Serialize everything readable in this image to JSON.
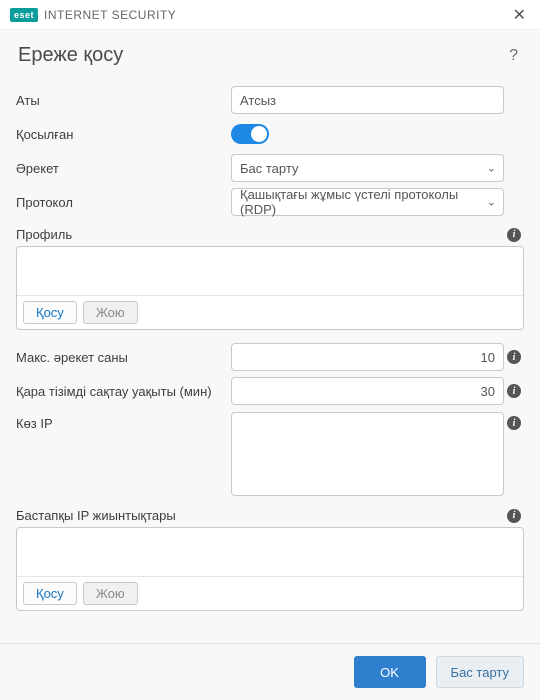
{
  "brand": {
    "badge": "eset",
    "product": "INTERNET SECURITY"
  },
  "window": {
    "close_glyph": "✕"
  },
  "header": {
    "title": "Ереже қосу",
    "help_glyph": "?"
  },
  "labels": {
    "name": "Аты",
    "enabled": "Қосылған",
    "action": "Әрекет",
    "protocol": "Протокол",
    "profile": "Профиль",
    "max_attempts": "Макс. әрекет саны",
    "blacklist_retention": "Қара тізімді сақтау уақыты (мин)",
    "source_ip": "Көз IP",
    "source_ip_sets": "Бастапқы IP жиынтықтары"
  },
  "values": {
    "name": "Атсыз",
    "enabled": true,
    "action": "Бас тарту",
    "protocol": "Қашықтағы жұмыс үстелі протоколы (RDP)",
    "max_attempts": "10",
    "blacklist_retention": "30",
    "source_ip": ""
  },
  "list_actions": {
    "add": "Қосу",
    "remove": "Жою"
  },
  "footer": {
    "ok": "OK",
    "cancel": "Бас тарту"
  },
  "glyphs": {
    "chevron_down": "⌄",
    "info": "i"
  }
}
